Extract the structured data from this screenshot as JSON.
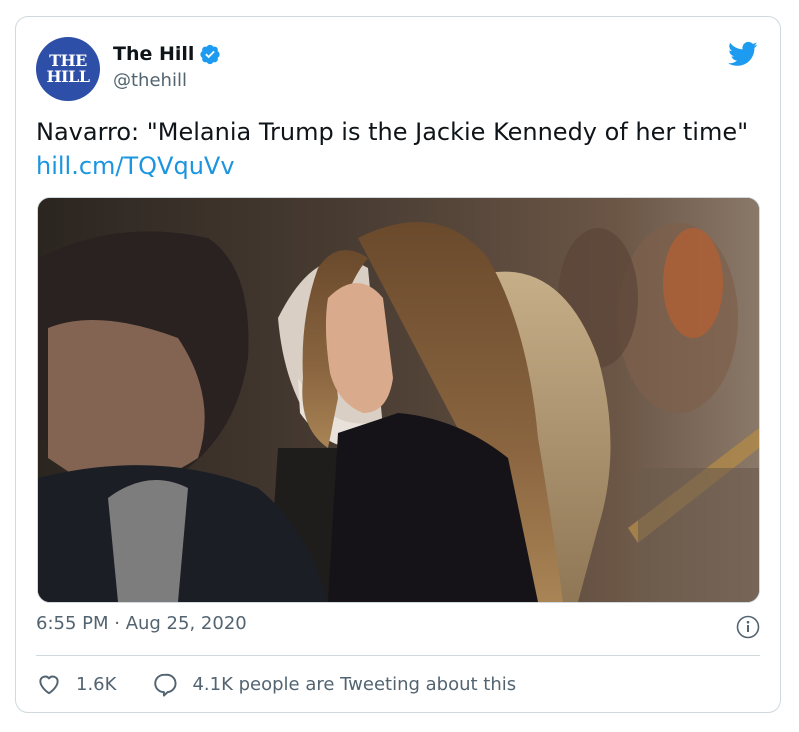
{
  "account": {
    "avatar_line1": "THE",
    "avatar_line2": "HILL",
    "display_name": "The Hill",
    "handle": "@thehill",
    "verified_icon": "verified-badge-icon",
    "avatar_color": "#2d4fa8"
  },
  "tweet": {
    "text": "Navarro: \"Melania Trump is the Jackie Kennedy of her time\"",
    "link": "hill.cm/TQVquVv",
    "link_color": "#1b95e0"
  },
  "media": {
    "icon": "photo"
  },
  "meta": {
    "timestamp": "6:55 PM · Aug 25, 2020"
  },
  "actions": {
    "likes": "1.6K",
    "tweeting": "4.1K people are Tweeting about this"
  },
  "colors": {
    "brand_blue": "#1d9bf0",
    "secondary_text": "#536471",
    "border": "#cfd9de"
  }
}
